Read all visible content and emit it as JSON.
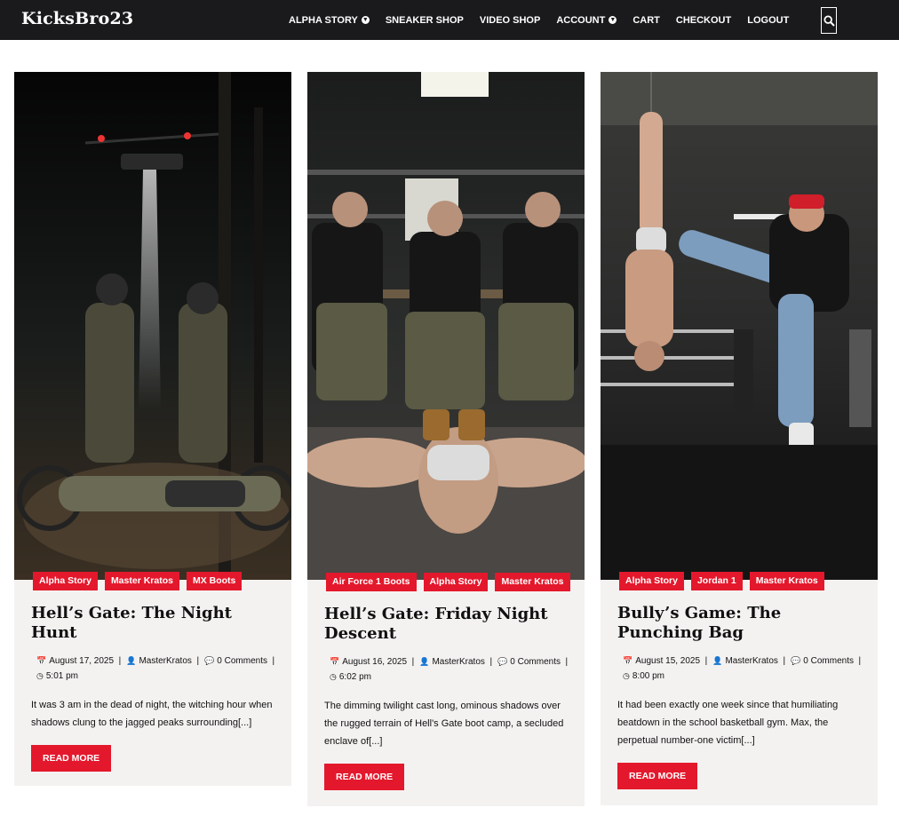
{
  "site": {
    "brand": "KicksBro23"
  },
  "nav": {
    "items": [
      {
        "label": "ALPHA STORY",
        "dropdown": true
      },
      {
        "label": "SNEAKER SHOP",
        "dropdown": false
      },
      {
        "label": "VIDEO SHOP",
        "dropdown": false
      },
      {
        "label": "ACCOUNT",
        "dropdown": true
      },
      {
        "label": "CART",
        "dropdown": false
      },
      {
        "label": "CHECKOUT",
        "dropdown": false
      },
      {
        "label": "LOGOUT",
        "dropdown": false
      }
    ],
    "search_icon": "search-icon"
  },
  "colors": {
    "accent": "#e4182c",
    "header_bg": "#1a1a1c",
    "card_bg": "#f4f2f1"
  },
  "posts": [
    {
      "tags": [
        "Alpha Story",
        "Master Kratos",
        "MX Boots"
      ],
      "title": "Hell’s Gate: The Night Hunt",
      "date": "August 17, 2025",
      "author": "MasterKratos",
      "comments_count": "0",
      "comments_word": "Comments",
      "time": "5:01 pm",
      "excerpt": "It was 3 am in the dead of night, the witching hour when shadows clung to the jagged peaks surrounding[...]",
      "read_more": "READ MORE"
    },
    {
      "tags": [
        "Air Force 1 Boots",
        "Alpha Story",
        "Master Kratos"
      ],
      "title": "Hell’s Gate: Friday Night Descent",
      "date": "August 16, 2025",
      "author": "MasterKratos",
      "comments_count": "0",
      "comments_word": "Comments",
      "time": "6:02 pm",
      "excerpt": "The dimming twilight cast long, ominous shadows over the rugged terrain of Hell's Gate boot camp, a secluded enclave of[...]",
      "read_more": "READ MORE"
    },
    {
      "tags": [
        "Alpha Story",
        "Jordan 1",
        "Master Kratos"
      ],
      "title": "Bully’s Game: The Punching Bag",
      "date": "August 15, 2025",
      "author": "MasterKratos",
      "comments_count": "0",
      "comments_word": "Comments",
      "time": "8:00 pm",
      "excerpt": "It had been exactly one week since that humiliating beatdown in the school basketball gym. Max, the perpetual number-one victim[...]",
      "read_more": "READ MORE"
    }
  ]
}
